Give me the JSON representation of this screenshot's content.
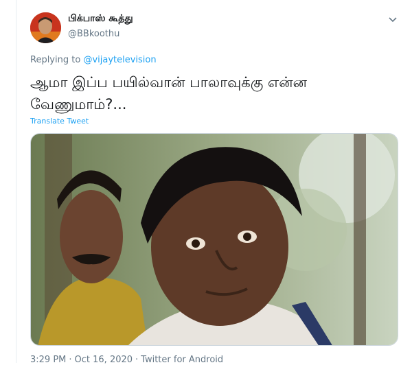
{
  "tweet": {
    "display_name": "பிக்பாஸ் கூத்து",
    "handle": "@BBkoothu",
    "replying_prefix": "Replying to ",
    "replying_to": "@vijaytelevision",
    "text_line1": "ஆமா இப்ப பயில்வான் பாலாவுக்கு என்ன",
    "text_line2": "வேணுமாம்?...",
    "translate_label": "Translate Tweet",
    "time": "3:29 PM",
    "date": "Oct 16, 2020",
    "source": "Twitter for Android",
    "separator": "·"
  },
  "icons": {
    "more": "chevron-down-icon"
  },
  "colors": {
    "link": "#1da1f2",
    "secondary_text": "#657786",
    "avatar_bg": "#c8341e"
  }
}
